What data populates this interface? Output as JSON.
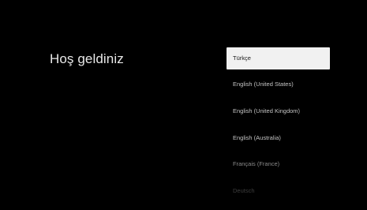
{
  "welcome": {
    "title": "Hoş geldiniz"
  },
  "languages": {
    "selected_index": 0,
    "items": [
      {
        "label": "Türkçe"
      },
      {
        "label": "English (United States)"
      },
      {
        "label": "English (United Kingdom)"
      },
      {
        "label": "English (Australia)"
      },
      {
        "label": "Français (France)"
      },
      {
        "label": "Deutsch"
      }
    ]
  },
  "colors": {
    "background": "#000000",
    "selected_background": "#f1f1f1",
    "selected_text": "#1a1a1a",
    "text": "#c4c4c4"
  }
}
